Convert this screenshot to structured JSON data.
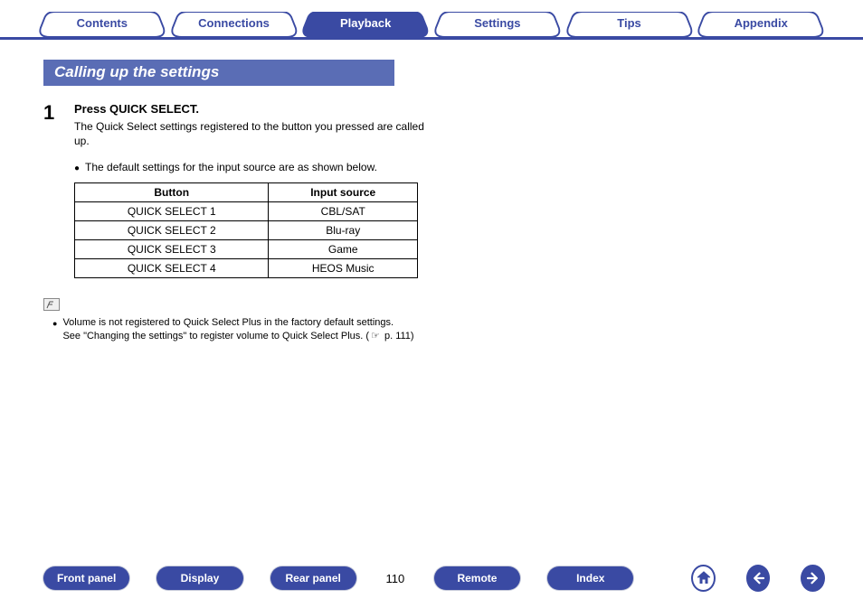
{
  "tabs": [
    {
      "label": "Contents",
      "active": false
    },
    {
      "label": "Connections",
      "active": false
    },
    {
      "label": "Playback",
      "active": true
    },
    {
      "label": "Settings",
      "active": false
    },
    {
      "label": "Tips",
      "active": false
    },
    {
      "label": "Appendix",
      "active": false
    }
  ],
  "section_title": "Calling up the settings",
  "step": {
    "number": "1",
    "heading": "Press QUICK SELECT.",
    "description": "The Quick Select settings registered to the button you pressed are called up."
  },
  "default_note": "The default settings for the input source are as shown below.",
  "table": {
    "headers": [
      "Button",
      "Input source"
    ],
    "rows": [
      [
        "QUICK SELECT 1",
        "CBL/SAT"
      ],
      [
        "QUICK SELECT 2",
        "Blu-ray"
      ],
      [
        "QUICK SELECT 3",
        "Game"
      ],
      [
        "QUICK SELECT 4",
        "HEOS Music"
      ]
    ]
  },
  "footnote": {
    "line1": "Volume is not registered to Quick Select Plus in the factory default settings.",
    "line2_a": "See \"Changing the settings\" to register volume to Quick Select Plus.  (",
    "line2_b": " p. 111)"
  },
  "footer": {
    "buttons": [
      "Front panel",
      "Display",
      "Rear panel",
      "Remote",
      "Index"
    ],
    "page": "110"
  }
}
